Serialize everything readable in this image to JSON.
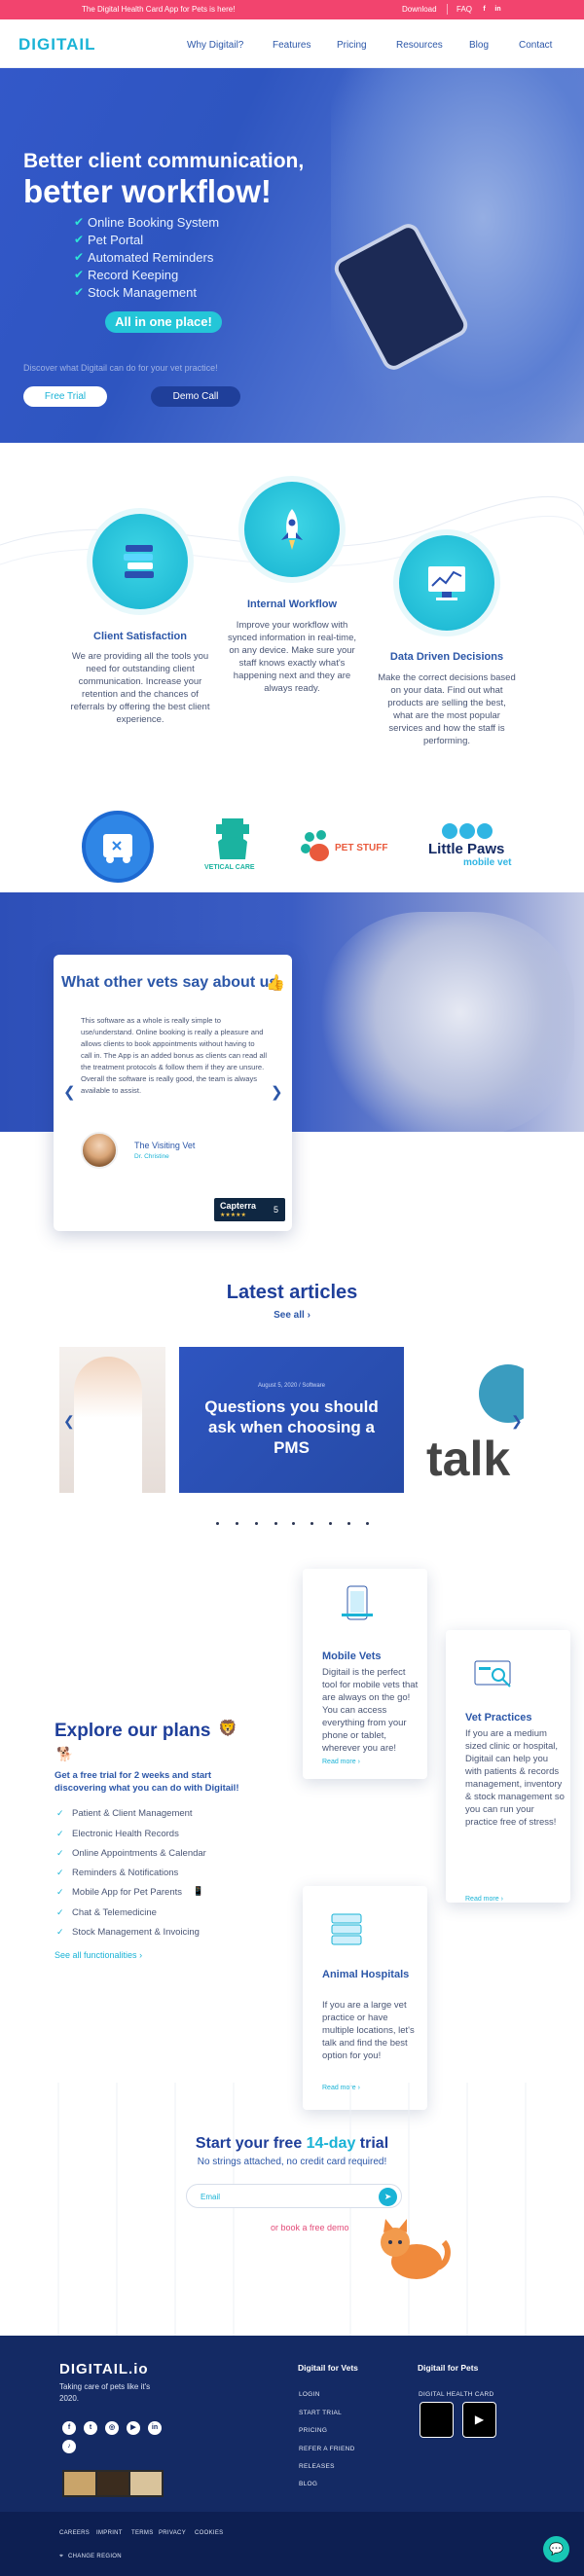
{
  "topbar": {
    "promo": "The Digital Health Card App for Pets is here!",
    "download": "Download",
    "faq": "FAQ"
  },
  "nav": {
    "logo": "DIGITAIL",
    "links": [
      "Why Digitail?",
      "Features",
      "Pricing",
      "Resources",
      "Blog",
      "Contact"
    ]
  },
  "hero": {
    "caption1": "Better client communication,",
    "caption2": "better workflow!",
    "features": [
      "Online Booking System",
      "Pet Portal",
      "Automated Reminders",
      "Record Keeping",
      "Stock Management"
    ],
    "allinone": "All in one place!",
    "discover": "Discover what Digitail can do for your vet practice!",
    "free_trial": "Free Trial",
    "demo_call": "Demo Call"
  },
  "features": [
    {
      "title": "Client Satisfaction",
      "body": "We are providing all the tools you need for outstanding client communication. Increase your retention and the chances of referrals by offering the best client experience."
    },
    {
      "title": "Internal Workflow",
      "body": "Improve your workflow with synced information in real-time, on any device. Make sure your staff knows exactly what's happening next and they are always ready."
    },
    {
      "title": "Data Driven Decisions",
      "body": "Make the correct decisions based on your data. Find out what products are selling the best, what are the most popular services and how the staff is performing."
    }
  ],
  "partners": [
    "VETICAL CARE",
    "PET STUFF",
    "Little Paws",
    "mobile vet"
  ],
  "testimonials": {
    "heading": "What other vets say about us",
    "quote": "This software as a whole is really simple to use/understand. Online booking is really a pleasure and allows clients to book appointments without having to call in. The App is an added bonus as clients can read all the treatment protocols & follow them if they are unsure. Overall the software is really good, the team is always available to assist.",
    "name": "The Visiting Vet",
    "role": "Dr. Christine",
    "capterra": "Capterra",
    "rating": "5"
  },
  "articles": {
    "title": "Latest articles",
    "see_all": "See all",
    "featured_meta": "August 5, 2020 / Software",
    "featured_title": "Questions you should ask when choosing a PMS",
    "right_text": "talk"
  },
  "plans": {
    "title": "Explore our plans",
    "lead": "Get a free trial for 2 weeks and start discovering what you can do with Digitail!",
    "items": [
      "Patient & Client Management",
      "Electronic Health Records",
      "Online Appointments & Calendar",
      "Reminders & Notifications",
      "Mobile App for Pet Parents",
      "Chat & Telemedicine",
      "Stock Management & Invoicing"
    ],
    "all_functionalities": "See all functionalities",
    "cards": [
      {
        "title": "Mobile Vets",
        "body": "Digitail is the perfect tool for mobile vets that are always on the go! You can access everything from your phone or tablet, wherever you are!",
        "read_more": "Read more"
      },
      {
        "title": "Vet Practices",
        "body": "If you are a medium sized clinic or hospital, Digitail can help you with patients & records management, inventory & stock management so you can run your practice free of stress!",
        "read_more": "Read more"
      },
      {
        "title": "Animal Hospitals",
        "body": "If you are a large vet practice or have multiple locations, let's talk and find the best option for you!",
        "read_more": "Read more"
      }
    ]
  },
  "cta": {
    "title_a": "Start your free ",
    "title_b": "14-day",
    "title_c": " trial",
    "subtitle": "No strings attached, no credit card required!",
    "email_placeholder": "Email",
    "or_demo": "or book a free demo"
  },
  "footer": {
    "logo": "DIGITAIL.io",
    "tagline": "Taking care of pets like it's 2020.",
    "col_vets_title": "Digitail for Vets",
    "col_vets": [
      "LOGIN",
      "START TRIAL",
      "PRICING",
      "REFER A FRIEND",
      "RELEASES",
      "BLOG"
    ],
    "col_pets_title": "Digitail for Pets",
    "col_pets": [
      "DIGITAL HEALTH CARD"
    ],
    "bottom_links": [
      "CAREERS",
      "IMPRINT",
      "TERMS",
      "PRIVACY",
      "COOKIES"
    ],
    "region": "CHANGE REGION"
  }
}
